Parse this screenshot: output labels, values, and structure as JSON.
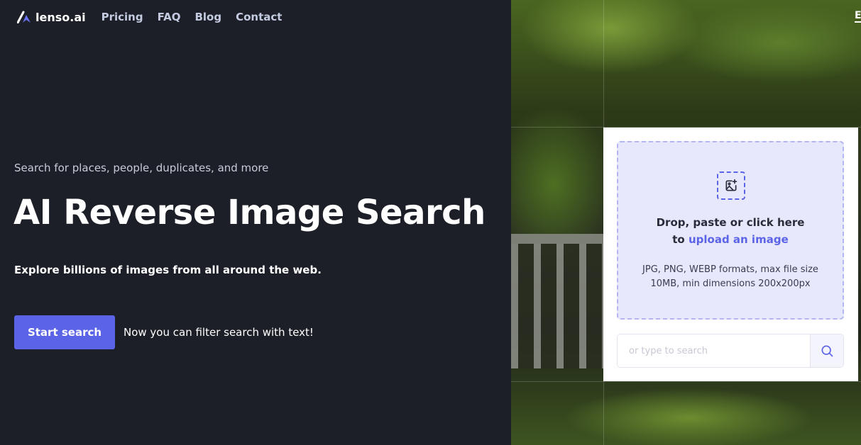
{
  "nav": {
    "brand": "lenso.ai",
    "links": [
      "Pricing",
      "FAQ",
      "Blog",
      "Contact"
    ],
    "language": "E"
  },
  "hero": {
    "subtitle": "Search for places, people, duplicates, and more",
    "title": "AI Reverse Image Search",
    "description": "Explore billions of images from all around the web.",
    "cta": "Start search",
    "note": "Now you can filter search with text!"
  },
  "upload": {
    "icon": "image-plus-icon",
    "line1": "Drop, paste or click here",
    "line2_prefix": "to",
    "line2_link": "upload an image",
    "formats": "JPG, PNG, WEBP formats, max file size 10MB, min dimensions 200x200px"
  },
  "search": {
    "placeholder": "or type to search",
    "icon": "search-icon"
  },
  "colors": {
    "accent": "#5b63e6",
    "background": "#1c1f27",
    "dropzone": "#e8e8fd"
  }
}
